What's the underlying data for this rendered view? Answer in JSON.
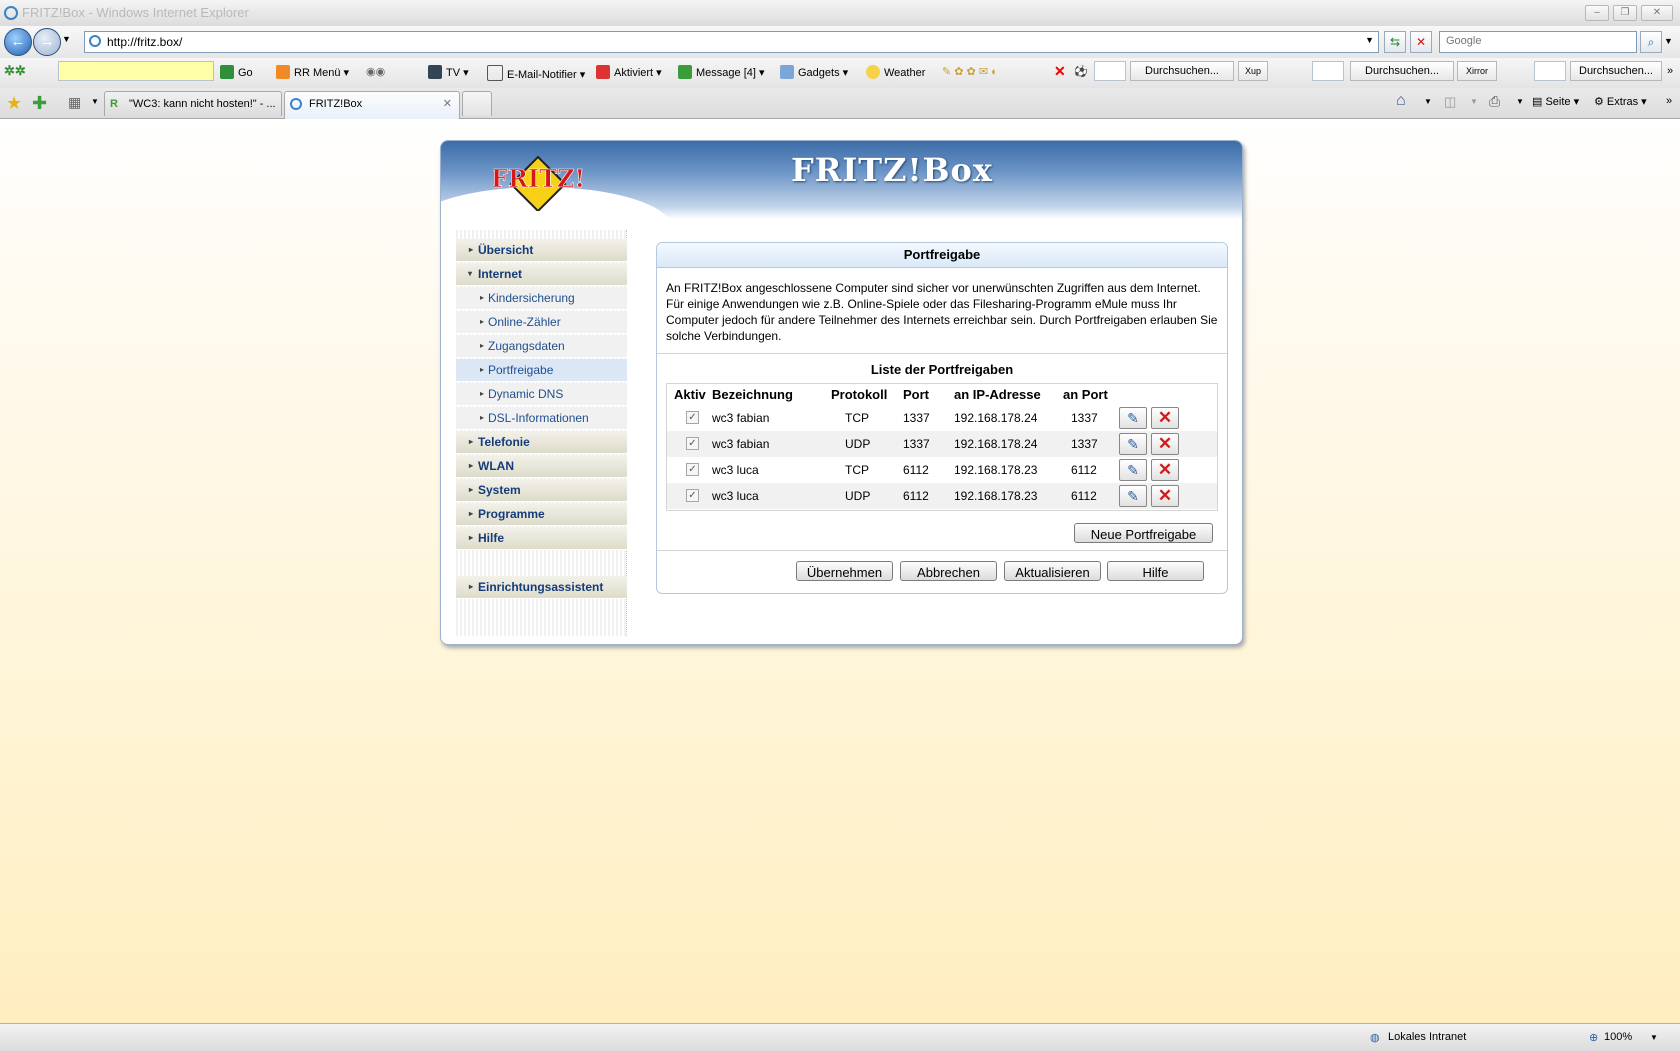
{
  "window": {
    "title": "FRITZ!Box - Windows Internet Explorer"
  },
  "nav": {
    "address": "http://fritz.box/",
    "search_placeholder": "Google"
  },
  "toolbar": {
    "items": [
      "Go",
      "RR Menü",
      "TV",
      "E-Mail-Notifier",
      "Aktiviert",
      "Message",
      "[4]",
      "Gadgets",
      "Weather"
    ],
    "search_buttons": [
      "Durchsuchen...",
      "Xup",
      "Durchsuchen...",
      "Xirror",
      "Durchsuchen..."
    ]
  },
  "tabs": [
    {
      "label": "\"WC3: kann nicht hosten!\" - ..."
    },
    {
      "label": "FRITZ!Box"
    }
  ],
  "commandbar": {
    "page": "Seite",
    "tools": "Extras"
  },
  "fritz": {
    "header_title": "FRITZ!Box",
    "logo_text": "FRITZ!",
    "sidebar": [
      {
        "label": "Übersicht",
        "level": "main",
        "expanded": false
      },
      {
        "label": "Internet",
        "level": "main",
        "expanded": true
      },
      {
        "label": "Kindersicherung",
        "level": "sub"
      },
      {
        "label": "Online-Zähler",
        "level": "sub"
      },
      {
        "label": "Zugangsdaten",
        "level": "sub"
      },
      {
        "label": "Portfreigabe",
        "level": "sub",
        "selected": true
      },
      {
        "label": "Dynamic DNS",
        "level": "sub"
      },
      {
        "label": "DSL-Informationen",
        "level": "sub"
      },
      {
        "label": "Telefonie",
        "level": "main"
      },
      {
        "label": "WLAN",
        "level": "main"
      },
      {
        "label": "System",
        "level": "main"
      },
      {
        "label": "Programme",
        "level": "main"
      },
      {
        "label": "Hilfe",
        "level": "main"
      },
      {
        "label": "Einrichtungsassistent",
        "level": "main"
      }
    ],
    "panel": {
      "title": "Portfreigabe",
      "intro": "An FRITZ!Box angeschlossene Computer sind sicher vor unerwünschten Zugriffen aus dem Internet. Für einige Anwendungen wie z.B. Online-Spiele oder das Filesharing-Programm eMule muss Ihr Computer jedoch für andere Teilnehmer des Internets erreichbar sein. Durch Portfreigaben erlauben Sie solche Verbindungen.",
      "list_title": "Liste der Portfreigaben",
      "columns": [
        "Aktiv",
        "Bezeichnung",
        "Protokoll",
        "Port",
        "an IP-Adresse",
        "an Port"
      ],
      "rows": [
        {
          "active": true,
          "name": "wc3 fabian",
          "protocol": "TCP",
          "port": "1337",
          "ip": "192.168.178.24",
          "to_port": "1337"
        },
        {
          "active": true,
          "name": "wc3 fabian",
          "protocol": "UDP",
          "port": "1337",
          "ip": "192.168.178.24",
          "to_port": "1337"
        },
        {
          "active": true,
          "name": "wc3 luca",
          "protocol": "TCP",
          "port": "6112",
          "ip": "192.168.178.23",
          "to_port": "6112"
        },
        {
          "active": true,
          "name": "wc3 luca",
          "protocol": "UDP",
          "port": "6112",
          "ip": "192.168.178.23",
          "to_port": "6112"
        }
      ],
      "new_button": "Neue Portfreigabe",
      "buttons": {
        "apply": "Übernehmen",
        "cancel": "Abbrechen",
        "refresh": "Aktualisieren",
        "help": "Hilfe"
      }
    }
  },
  "status": {
    "zone": "Lokales Intranet",
    "zoom": "100%"
  }
}
